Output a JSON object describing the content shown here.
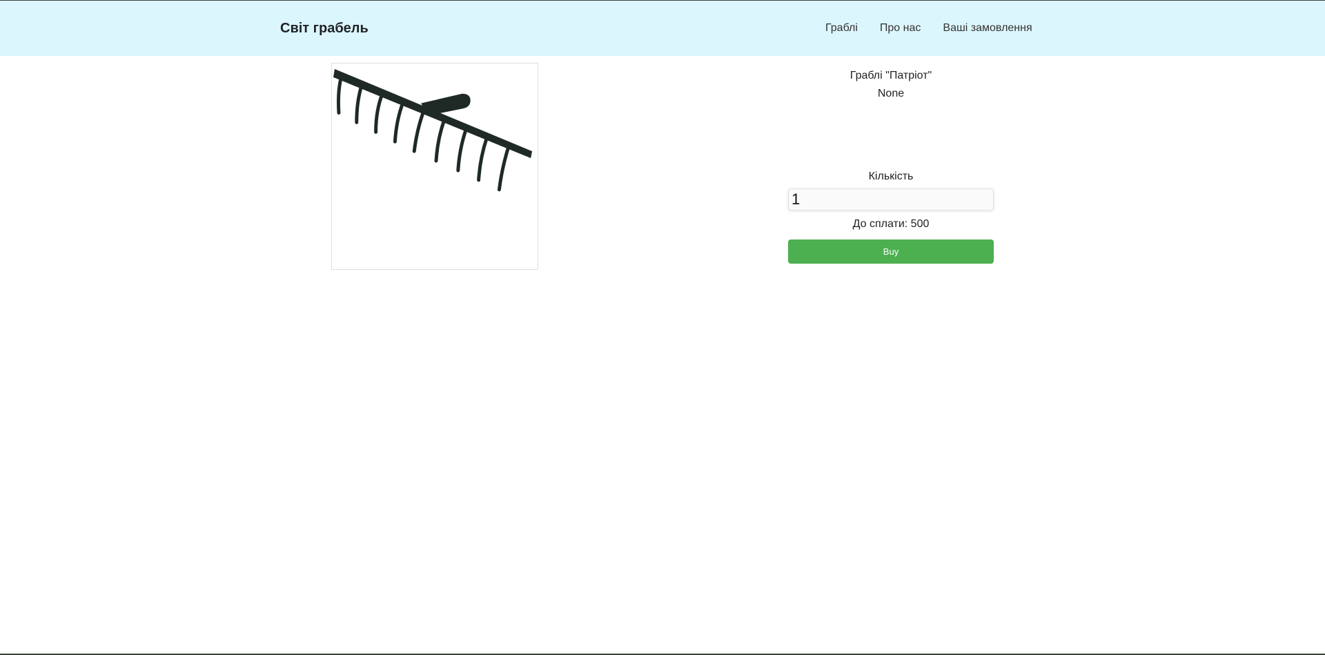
{
  "header": {
    "brand": "Світ грабель",
    "nav": [
      {
        "label": "Граблі"
      },
      {
        "label": "Про нас"
      },
      {
        "label": "Ваші замовлення"
      }
    ]
  },
  "product": {
    "title": "Граблі \"Патріот\"",
    "description": "None",
    "image_icon": "rake-image",
    "quantity_label": "Кількість",
    "quantity_value": "1",
    "total_text": "До сплати: 500",
    "buy_label": "Buy"
  },
  "colors": {
    "header_bg": "#dcf6fd",
    "buy_button": "#4caf50"
  }
}
